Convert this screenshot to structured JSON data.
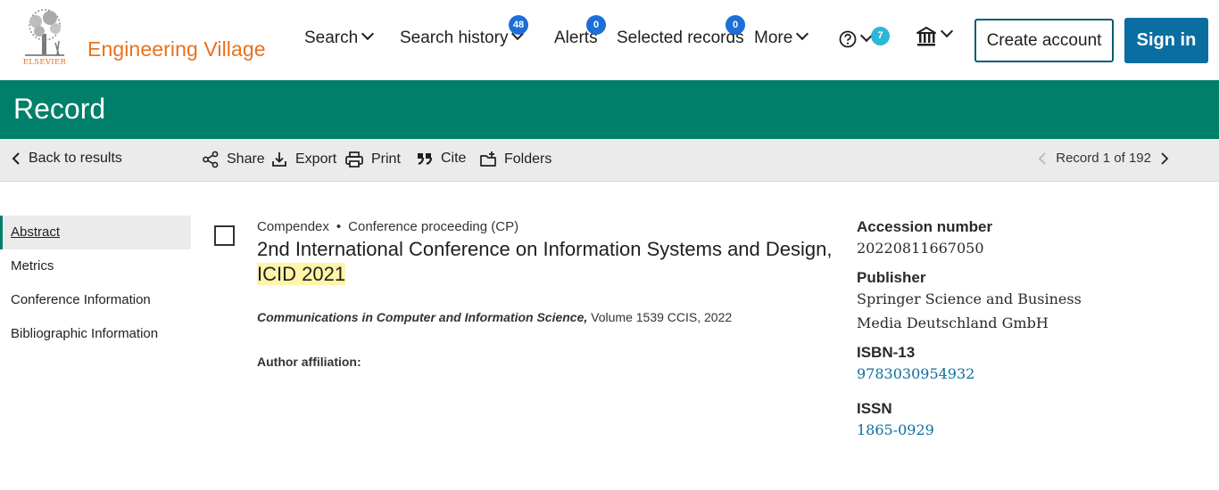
{
  "header": {
    "brand": "Engineering Village",
    "logo_text": "ELSEVIER",
    "nav": {
      "search": "Search",
      "search_history": "Search history",
      "search_history_count": "48",
      "alerts": "Alerts",
      "alerts_count": "0",
      "selected_records": "Selected records",
      "selected_records_count": "0",
      "more": "More",
      "help_count": "7"
    },
    "create_account": "Create account",
    "sign_in": "Sign in"
  },
  "title_bar": {
    "title": "Record"
  },
  "toolbar": {
    "back": "Back to results",
    "share": "Share",
    "export": "Export",
    "print": "Print",
    "cite": "Cite",
    "folders": "Folders",
    "record_position": "Record 1 of 192"
  },
  "sidebar": {
    "items": [
      {
        "label": "Abstract"
      },
      {
        "label": "Metrics"
      },
      {
        "label": "Conference Information"
      },
      {
        "label": "Bibliographic Information"
      }
    ]
  },
  "record": {
    "database": "Compendex",
    "doc_type": "Conference proceeding (CP)",
    "title_part1": "2nd International Conference on Information Systems and Design,",
    "title_highlight": "ICID 2021",
    "source_title": "Communications in Computer and Information Science,",
    "source_detail": " Volume 1539 CCIS, 2022",
    "author_affiliation_label": "Author affiliation:"
  },
  "details": {
    "accession_label": "Accession number",
    "accession_value": "20220811667050",
    "publisher_label": "Publisher",
    "publisher_value": "Springer Science and Business Media Deutschland GmbH",
    "isbn_label": "ISBN-13",
    "isbn_value": "9783030954932",
    "issn_label": "ISSN",
    "issn_value": "1865-0929"
  },
  "colors": {
    "brand_orange": "#e9711c",
    "title_bar_green": "#00806a",
    "primary_blue": "#0b6ea0",
    "badge_blue": "#1b6fd6",
    "highlight_yellow": "#fff5a8"
  }
}
